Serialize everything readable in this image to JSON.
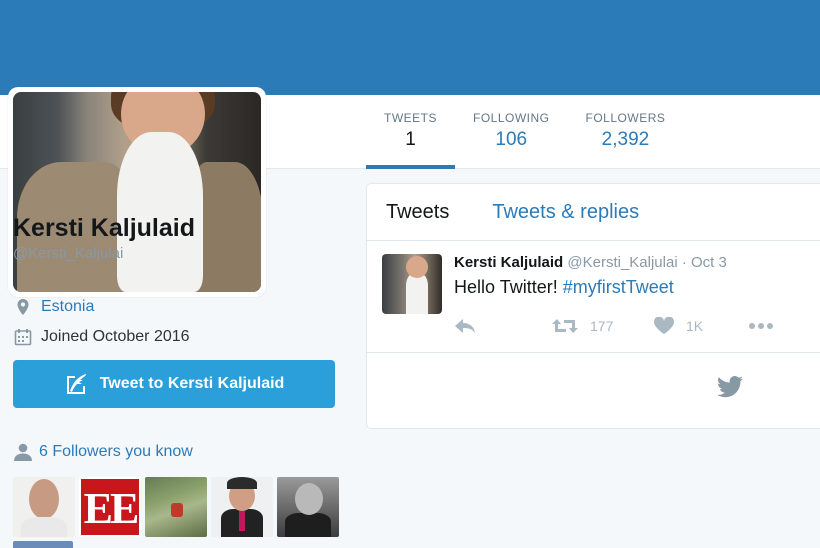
{
  "header": {
    "stats": [
      {
        "label": "TWEETS",
        "value": "1",
        "active": true
      },
      {
        "label": "FOLLOWING",
        "value": "106"
      },
      {
        "label": "FOLLOWERS",
        "value": "2,392"
      }
    ]
  },
  "profile": {
    "name": "Kersti Kaljulaid",
    "handle": "@Kersti_Kaljulai",
    "location": "Estonia",
    "joined": "Joined October 2016",
    "tweet_to_label": "Tweet to Kersti Kaljulaid",
    "followers_you_know": "6 Followers you know",
    "followers_you_know_logo_text": "EE"
  },
  "timeline": {
    "tabs": [
      {
        "label": "Tweets",
        "active": true
      },
      {
        "label": "Tweets & replies"
      }
    ],
    "tweet": {
      "name": "Kersti Kaljulaid",
      "handle": "@Kersti_Kaljulai",
      "date": "· Oct 3",
      "text_before": "Hello Twitter! ",
      "hashtag": "#myfirstTweet",
      "retweets": "177",
      "likes": "1K"
    }
  },
  "colors": {
    "banner": "#2b7bb9",
    "accent": "#2b7bb9",
    "button": "#2b9fd9",
    "muted": "#8899a6"
  },
  "icons": [
    "location-pin-icon",
    "calendar-icon",
    "quill-icon",
    "person-icon",
    "reply-icon",
    "retweet-icon",
    "heart-icon",
    "more-icon",
    "twitter-bird-icon"
  ]
}
